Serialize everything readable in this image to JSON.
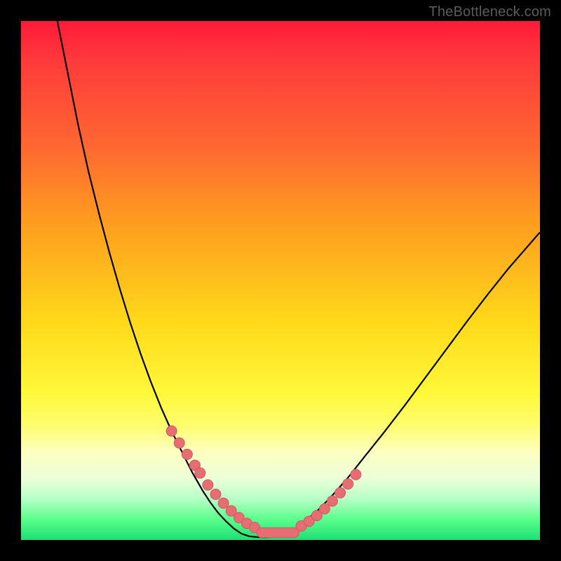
{
  "watermark": "TheBottleneck.com",
  "colors": {
    "frame": "#000000",
    "curve": "#000000",
    "marker_fill": "#e86d73",
    "marker_stroke": "#cc5a62",
    "gradient_stops": [
      {
        "pct": 0,
        "hex": "#ff1a3a"
      },
      {
        "pct": 8,
        "hex": "#ff3b3b"
      },
      {
        "pct": 25,
        "hex": "#ff6a30"
      },
      {
        "pct": 38,
        "hex": "#ff9a20"
      },
      {
        "pct": 58,
        "hex": "#ffd91a"
      },
      {
        "pct": 72,
        "hex": "#fff93a"
      },
      {
        "pct": 78,
        "hex": "#fffc70"
      },
      {
        "pct": 83,
        "hex": "#fdffc0"
      },
      {
        "pct": 88,
        "hex": "#edffd8"
      },
      {
        "pct": 92,
        "hex": "#b8ffc8"
      },
      {
        "pct": 96,
        "hex": "#5bff8c"
      },
      {
        "pct": 100,
        "hex": "#1be072"
      }
    ]
  },
  "chart_data": {
    "type": "line",
    "title": "",
    "xlabel": "",
    "ylabel": "",
    "xlim": [
      0,
      100
    ],
    "ylim": [
      0,
      100
    ],
    "grid": false,
    "note": "No numeric axes visible; values are normalized 0–100 to plot pixel coordinates.",
    "series": [
      {
        "name": "left-curve",
        "x": [
          7,
          9,
          11,
          13,
          15,
          17,
          19,
          21,
          23,
          25,
          27,
          29,
          31,
          33,
          35,
          36.5,
          38,
          39.5,
          41,
          42.5
        ],
        "y": [
          100,
          90,
          80,
          71,
          63,
          55.5,
          48.5,
          42,
          36,
          30.5,
          25.5,
          21,
          17,
          13,
          9.5,
          7.2,
          5.2,
          3.6,
          2.2,
          1.2
        ]
      },
      {
        "name": "valley-flat",
        "x": [
          42.5,
          44,
          45.5,
          47,
          48.5,
          50,
          51.2
        ],
        "y": [
          1.2,
          0.7,
          0.55,
          0.5,
          0.55,
          0.7,
          1.0
        ]
      },
      {
        "name": "right-curve",
        "x": [
          51.2,
          53,
          55,
          57.5,
          60,
          63,
          66,
          70,
          74,
          78,
          82,
          86,
          90,
          94,
          98,
          100
        ],
        "y": [
          1.0,
          2.2,
          3.8,
          6.0,
          8.6,
          12.0,
          15.8,
          20.8,
          26.0,
          31.4,
          36.8,
          42.2,
          47.4,
          52.4,
          57.0,
          59.3
        ]
      }
    ],
    "markers": {
      "name": "highlighted-points",
      "style": "pill-dots",
      "x": [
        29,
        30.5,
        32,
        33.5,
        34.5,
        36,
        37.5,
        39,
        40.5,
        42,
        43.5,
        45,
        46.5,
        48,
        49.5,
        51,
        52.5,
        54,
        55.5,
        57,
        58.5,
        60,
        61.5,
        63,
        64.5
      ],
      "y": [
        21,
        18.7,
        16.5,
        14.4,
        12.9,
        10.6,
        8.8,
        7.1,
        5.6,
        4.3,
        3.2,
        2.4,
        1.8,
        1.5,
        1.4,
        1.5,
        2.0,
        2.7,
        3.6,
        4.7,
        6.0,
        7.5,
        9.1,
        10.8,
        12.6
      ]
    }
  }
}
